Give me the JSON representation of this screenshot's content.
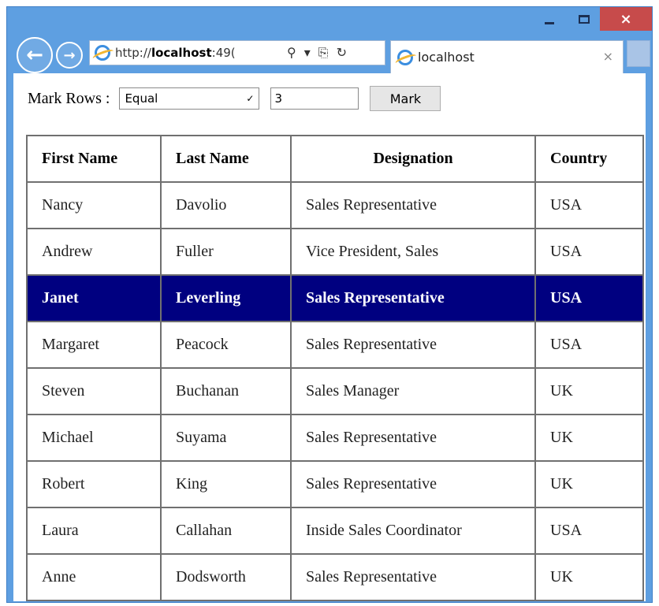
{
  "browser": {
    "address_prefix": "http://",
    "address_host": "localhost",
    "address_port": ":49(",
    "tab_title": "localhost",
    "search_glyph": "⚲",
    "dropdown_glyph": "▾",
    "compat_glyph": "⎘",
    "refresh_glyph": "↻",
    "tab_close_glyph": "×",
    "close_glyph": "×",
    "back_glyph": "←",
    "forward_glyph": "→"
  },
  "controls": {
    "label": "Mark Rows :",
    "operator_selected": "Equal",
    "select_arrow": "✓",
    "row_value": "3",
    "mark_button": "Mark"
  },
  "table": {
    "columns": [
      "First Name",
      "Last Name",
      "Designation",
      "Country"
    ],
    "highlighted_row_index": 2,
    "highlight_color": "#000080",
    "rows": [
      [
        "Nancy",
        "Davolio",
        "Sales Representative",
        "USA"
      ],
      [
        "Andrew",
        "Fuller",
        "Vice President, Sales",
        "USA"
      ],
      [
        "Janet",
        "Leverling",
        "Sales Representative",
        "USA"
      ],
      [
        "Margaret",
        "Peacock",
        "Sales Representative",
        "USA"
      ],
      [
        "Steven",
        "Buchanan",
        "Sales Manager",
        "UK"
      ],
      [
        "Michael",
        "Suyama",
        "Sales Representative",
        "UK"
      ],
      [
        "Robert",
        "King",
        "Sales Representative",
        "UK"
      ],
      [
        "Laura",
        "Callahan",
        "Inside Sales Coordinator",
        "USA"
      ],
      [
        "Anne",
        "Dodsworth",
        "Sales Representative",
        "UK"
      ]
    ]
  },
  "colors": {
    "chrome": "#5e9fe1",
    "close_button": "#c74b4b"
  }
}
